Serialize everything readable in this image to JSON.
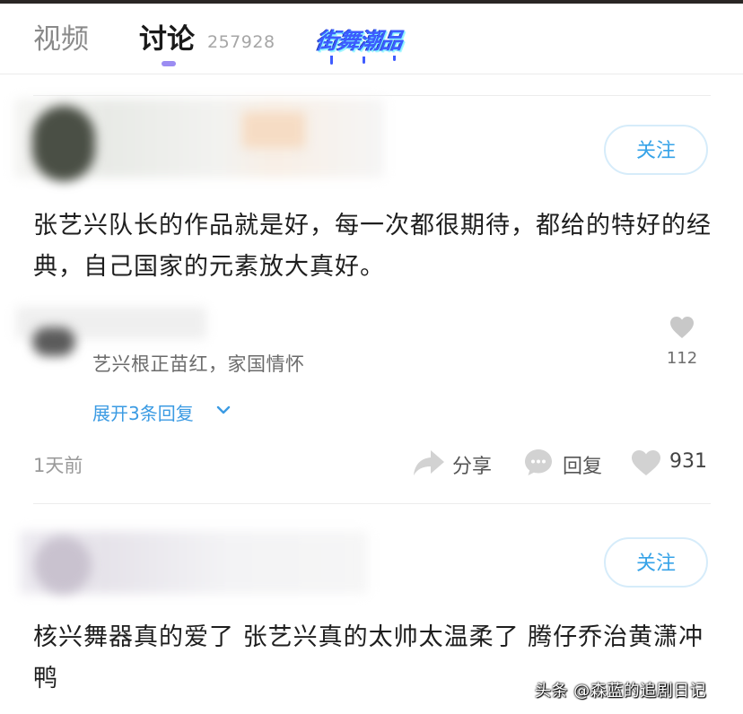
{
  "tabs": {
    "video_label": "视频",
    "discuss_label": "讨论",
    "discuss_count": "257928",
    "active_tab": "讨论",
    "accent_color": "#9b8cf2"
  },
  "brand_logo": {
    "text": "街舞潮品",
    "color": "#3c5cff"
  },
  "comments": [
    {
      "follow_label": "关注",
      "text": "张艺兴队长的作品就是好，每一次都很期待，都给的特好的经典，自己国家的元素放大真好。",
      "reply": {
        "text": "艺兴根正苗红，家国情怀",
        "likes": "112",
        "expand_label": "展开3条回复"
      },
      "time": "1天前",
      "share_label": "分享",
      "reply_label": "回复",
      "likes": "931"
    },
    {
      "follow_label": "关注",
      "text": "核兴舞器真的爱了 张艺兴真的太帅太温柔了 腾仔乔治黄潇冲鸭"
    }
  ],
  "watermark": "头条 @森蓝的追剧日记",
  "icons": {
    "like": "heart-icon",
    "share": "share-arrow-icon",
    "reply": "speech-bubble-icon",
    "expand": "chevron-down-icon"
  },
  "colors": {
    "link": "#3b9be3",
    "follow_text": "#36a3e8",
    "follow_border": "#d6ecfa"
  }
}
